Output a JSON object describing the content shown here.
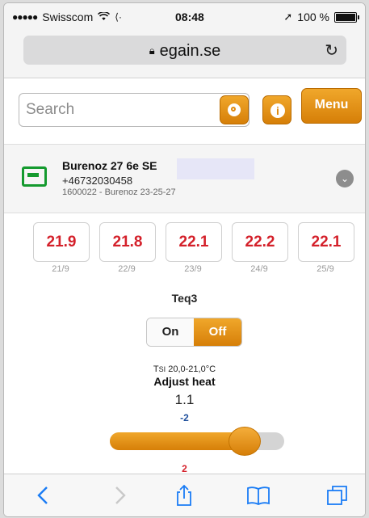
{
  "status_bar": {
    "carrier": "Swisscom",
    "time": "08:48",
    "battery": "100 %",
    "battery_level": 1.0
  },
  "browser": {
    "url": "egain.se"
  },
  "search": {
    "placeholder": "Search"
  },
  "buttons": {
    "menu": "Menu"
  },
  "device": {
    "name": "Burenoz 27 6e SE",
    "phone": "+46732030458",
    "subtitle": "1600022 - Burenoz 23-25-27"
  },
  "temperatures": [
    {
      "value": "21.9",
      "date": "21/9"
    },
    {
      "value": "21.8",
      "date": "22/9"
    },
    {
      "value": "22.1",
      "date": "23/9"
    },
    {
      "value": "22.2",
      "date": "24/9"
    },
    {
      "value": "22.1",
      "date": "25/9"
    }
  ],
  "teq_label": "Teq3",
  "toggle": {
    "on_label": "On",
    "off_label": "Off",
    "selected": "Off"
  },
  "tsi": {
    "prefix": "T",
    "sub": "SI",
    "range": "20,0-21,0°C"
  },
  "adjust": {
    "label": "Adjust heat",
    "value": "1.1",
    "min": "-2",
    "max": "2",
    "level": 1.1
  },
  "colors": {
    "accent": "#e08b0f",
    "temp_red": "#d4202a",
    "device_green": "#149a2e",
    "ios_blue": "#1a7cf5"
  },
  "icons": [
    "search-icon",
    "info-icon",
    "device-icon",
    "chevron-down-icon",
    "back-icon",
    "forward-icon",
    "share-icon",
    "bookmarks-icon",
    "tabs-icon",
    "reload-icon",
    "lock-icon",
    "wifi-icon",
    "location-icon"
  ]
}
